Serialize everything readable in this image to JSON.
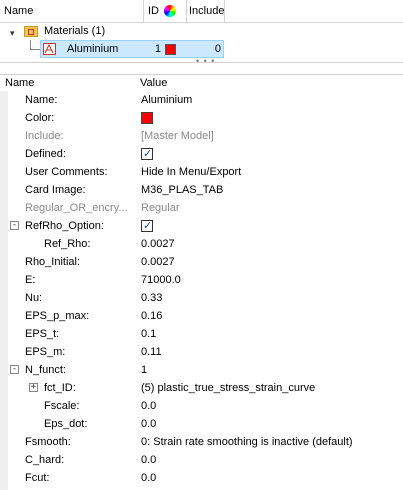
{
  "tree": {
    "columns": {
      "name": "Name",
      "id": "ID",
      "include": "Include"
    },
    "folder": {
      "label": "Materials (1)",
      "expanded": true
    },
    "material": {
      "name": "Aluminium",
      "id": "1",
      "color": "#ff0000",
      "include": "0"
    }
  },
  "grid": {
    "header": {
      "name": "Name",
      "value": "Value"
    },
    "rows": [
      {
        "name": "Name:",
        "value": "Aluminium"
      },
      {
        "name": "Color:",
        "value_color": "#ff0000"
      },
      {
        "name": "Include:",
        "value": "[Master Model]",
        "disabled": true
      },
      {
        "name": "Defined:",
        "checked": true
      },
      {
        "name": "User Comments:",
        "value": "Hide In Menu/Export"
      },
      {
        "name": "Card Image:",
        "value": "M36_PLAS_TAB"
      },
      {
        "name": "Regular_OR_encry...",
        "value": "Regular",
        "disabled": true
      },
      {
        "name": "RefRho_Option:",
        "checked": true,
        "group": "collapsed-minus"
      },
      {
        "name": "Ref_Rho:",
        "value": "0.0027"
      },
      {
        "name": "Rho_Initial:",
        "value": "0.0027"
      },
      {
        "name": "E:",
        "value": "71000.0"
      },
      {
        "name": "Nu:",
        "value": "0.33"
      },
      {
        "name": "EPS_p_max:",
        "value": "0.16"
      },
      {
        "name": "EPS_t:",
        "value": "0.1"
      },
      {
        "name": "EPS_m:",
        "value": "0.11"
      },
      {
        "name": "N_funct:",
        "value": "1",
        "group": "minus"
      },
      {
        "name": "fct_ID:",
        "value": "(5) plastic_true_stress_strain_curve",
        "group": "plus"
      },
      {
        "name": "Fscale:",
        "value": "0.0"
      },
      {
        "name": "Eps_dot:",
        "value": "0.0"
      },
      {
        "name": "Fsmooth:",
        "value": "0: Strain rate smoothing is inactive (default)"
      },
      {
        "name": "C_hard:",
        "value": "0.0"
      },
      {
        "name": "Fcut:",
        "value": "0.0"
      }
    ]
  }
}
